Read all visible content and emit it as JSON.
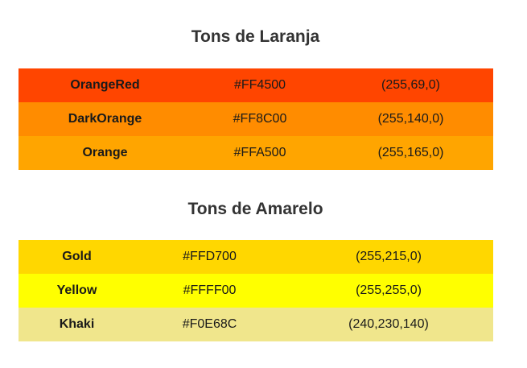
{
  "orange_section": {
    "title": "Tons de Laranja",
    "rows": [
      {
        "name": "OrangeRed",
        "hex": "#FF4500",
        "rgb": "(255,69,0)",
        "color": "#FF4500"
      },
      {
        "name": "DarkOrange",
        "hex": "#FF8C00",
        "rgb": "(255,140,0)",
        "color": "#FF8C00"
      },
      {
        "name": "Orange",
        "hex": "#FFA500",
        "rgb": "(255,165,0)",
        "color": "#FFA500"
      }
    ]
  },
  "yellow_section": {
    "title": "Tons de Amarelo",
    "rows": [
      {
        "name": "Gold",
        "hex": "#FFD700",
        "rgb": "(255,215,0)",
        "color": "#FFD700"
      },
      {
        "name": "Yellow",
        "hex": "#FFFF00",
        "rgb": "(255,255,0)",
        "color": "#FFFF00"
      },
      {
        "name": "Khaki",
        "hex": "#F0E68C",
        "rgb": "(240,230,140)",
        "color": "#F0E68C"
      }
    ]
  }
}
